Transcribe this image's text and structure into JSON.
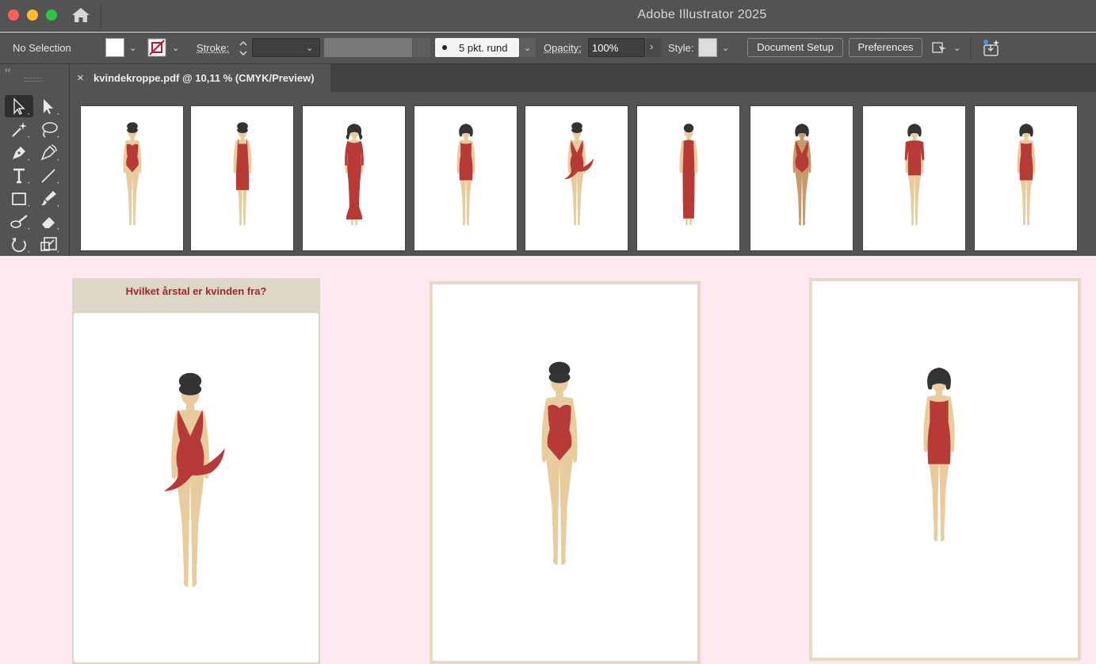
{
  "app": {
    "title": "Adobe Illustrator 2025"
  },
  "window": {
    "close_color": "#ff5f57",
    "minimize_color": "#febc2e",
    "zoom_color": "#28c840"
  },
  "control_bar": {
    "selection_label": "No Selection",
    "stroke_label": "Stroke:",
    "brush_value": "5 pkt. rund",
    "opacity_label": "Opacity:",
    "opacity_value": "100%",
    "style_label": "Style:",
    "document_setup_label": "Document Setup",
    "preferences_label": "Preferences"
  },
  "document": {
    "tab_title": "kvindekroppe.pdf @ 10,11 % (CMYK/Preview)",
    "close_glyph": "×"
  },
  "tools": [
    "selection-tool",
    "direct-selection-tool",
    "magic-wand-tool",
    "lasso-tool",
    "pen-tool",
    "curvature-tool",
    "type-tool",
    "line-tool",
    "rectangle-tool",
    "paintbrush-tool",
    "shaper-tool",
    "eraser-tool",
    "rotate-tool",
    "scale-tool"
  ],
  "artboards": [
    {
      "outfit": "corset",
      "hair": "updo",
      "skin": "light"
    },
    {
      "outfit": "slip-dress",
      "hair": "updo",
      "skin": "light"
    },
    {
      "outfit": "mermaid-gown",
      "hair": "wavy",
      "skin": "light"
    },
    {
      "outfit": "strapless-mini",
      "hair": "bob",
      "skin": "light"
    },
    {
      "outfit": "flowing-swimsuit",
      "hair": "updo",
      "skin": "light"
    },
    {
      "outfit": "column-dress",
      "hair": "short",
      "skin": "light"
    },
    {
      "outfit": "v-swimsuit",
      "hair": "bob",
      "skin": "tan"
    },
    {
      "outfit": "power-suit-dress",
      "hair": "bob",
      "skin": "light"
    },
    {
      "outfit": "strapless-mini",
      "hair": "bob",
      "skin": "light"
    }
  ],
  "quiz": {
    "question": "Hvilket årstal er kvinden fra?"
  },
  "colors": {
    "dress": "#b83a36",
    "skin": "#e8cc9e",
    "skin_tan": "#c79a6b",
    "hair": "#333333",
    "page_bg": "#fde8ef",
    "card_frame": "#e4d8c7"
  }
}
